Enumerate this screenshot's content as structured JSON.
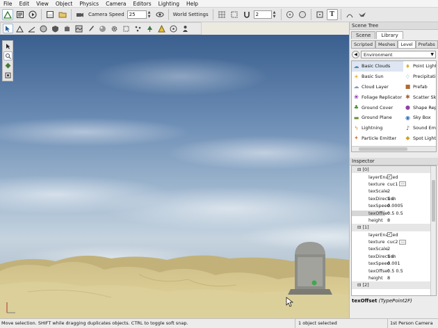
{
  "menu": [
    "File",
    "Edit",
    "View",
    "Object",
    "Physics",
    "Camera",
    "Editors",
    "Lighting",
    "Help"
  ],
  "toolbar": {
    "camera_speed_label": "Camera Speed",
    "camera_speed_value": "25",
    "world_settings_label": "World Settings",
    "snap_value": "2"
  },
  "right_panel": {
    "scene_tree_title": "Scene Tree",
    "tabs": [
      "Scene",
      "Library"
    ],
    "active_tab": "Library",
    "subtabs": [
      "Scripted",
      "Meshes",
      "Level",
      "Prefabs"
    ],
    "active_subtab": "Level",
    "environment_selected": "Environment",
    "library_items_left": [
      {
        "label": "Basic Clouds",
        "icon": "cloud-icon"
      },
      {
        "label": "Basic Sun",
        "icon": "sun-icon"
      },
      {
        "label": "Cloud Layer",
        "icon": "cloud-layer-icon"
      },
      {
        "label": "Foliage Replicator",
        "icon": "foliage-icon"
      },
      {
        "label": "Ground Cover",
        "icon": "ground-cover-icon"
      },
      {
        "label": "Ground Plane",
        "icon": "ground-plane-icon"
      },
      {
        "label": "Lightning",
        "icon": "lightning-icon"
      },
      {
        "label": "Particle Emitter",
        "icon": "particle-icon"
      }
    ],
    "library_items_right": [
      {
        "label": "Point Light",
        "icon": "bulb-icon"
      },
      {
        "label": "Precipitation",
        "icon": "rain-icon"
      },
      {
        "label": "Prefab",
        "icon": "prefab-icon"
      },
      {
        "label": "Scatter Sk",
        "icon": "scatter-icon"
      },
      {
        "label": "Shape Rep",
        "icon": "shape-icon"
      },
      {
        "label": "Sky Box",
        "icon": "skybox-icon"
      },
      {
        "label": "Sound Emit",
        "icon": "sound-icon"
      },
      {
        "label": "Spot Light",
        "icon": "spotlight-icon"
      }
    ],
    "inspector_title": "Inspector",
    "inspector_rows": [
      {
        "key": "[0]",
        "value": "",
        "type": "group"
      },
      {
        "key": "layerEnabled",
        "value": "",
        "type": "check"
      },
      {
        "key": "texture",
        "value": "cuc1",
        "type": "file"
      },
      {
        "key": "texScale",
        "value": "2",
        "type": "text"
      },
      {
        "key": "texDirection",
        "value": "1 0",
        "type": "text"
      },
      {
        "key": "texSpeed",
        "value": "0.0005",
        "type": "text"
      },
      {
        "key": "texOffset",
        "value": "0.5 0.5",
        "type": "hl"
      },
      {
        "key": "height",
        "value": "8",
        "type": "text"
      },
      {
        "key": "[1]",
        "value": "",
        "type": "group"
      },
      {
        "key": "layerEnabled",
        "value": "",
        "type": "check"
      },
      {
        "key": "texture",
        "value": "cuc2",
        "type": "file"
      },
      {
        "key": "texScale",
        "value": "2",
        "type": "text"
      },
      {
        "key": "texDirection",
        "value": "1 0",
        "type": "text"
      },
      {
        "key": "texSpeed",
        "value": "0.001",
        "type": "text"
      },
      {
        "key": "texOffset",
        "value": "0.5 0.5",
        "type": "text"
      },
      {
        "key": "height",
        "value": "8",
        "type": "text"
      },
      {
        "key": "[2]",
        "value": "",
        "type": "group"
      }
    ],
    "field_name": "texOffset",
    "field_type": "(TypePoint2F)"
  },
  "status": {
    "hint": "Move selection.  SHIFT while dragging duplicates objects.  CTRL to toggle soft snap.",
    "selection": "1 object selected",
    "camera": "1st Person Camera"
  },
  "colors": {
    "sky_top": "#3a5f8e",
    "sand": "#d8c98f",
    "selection_blue": "#dde6f2"
  }
}
